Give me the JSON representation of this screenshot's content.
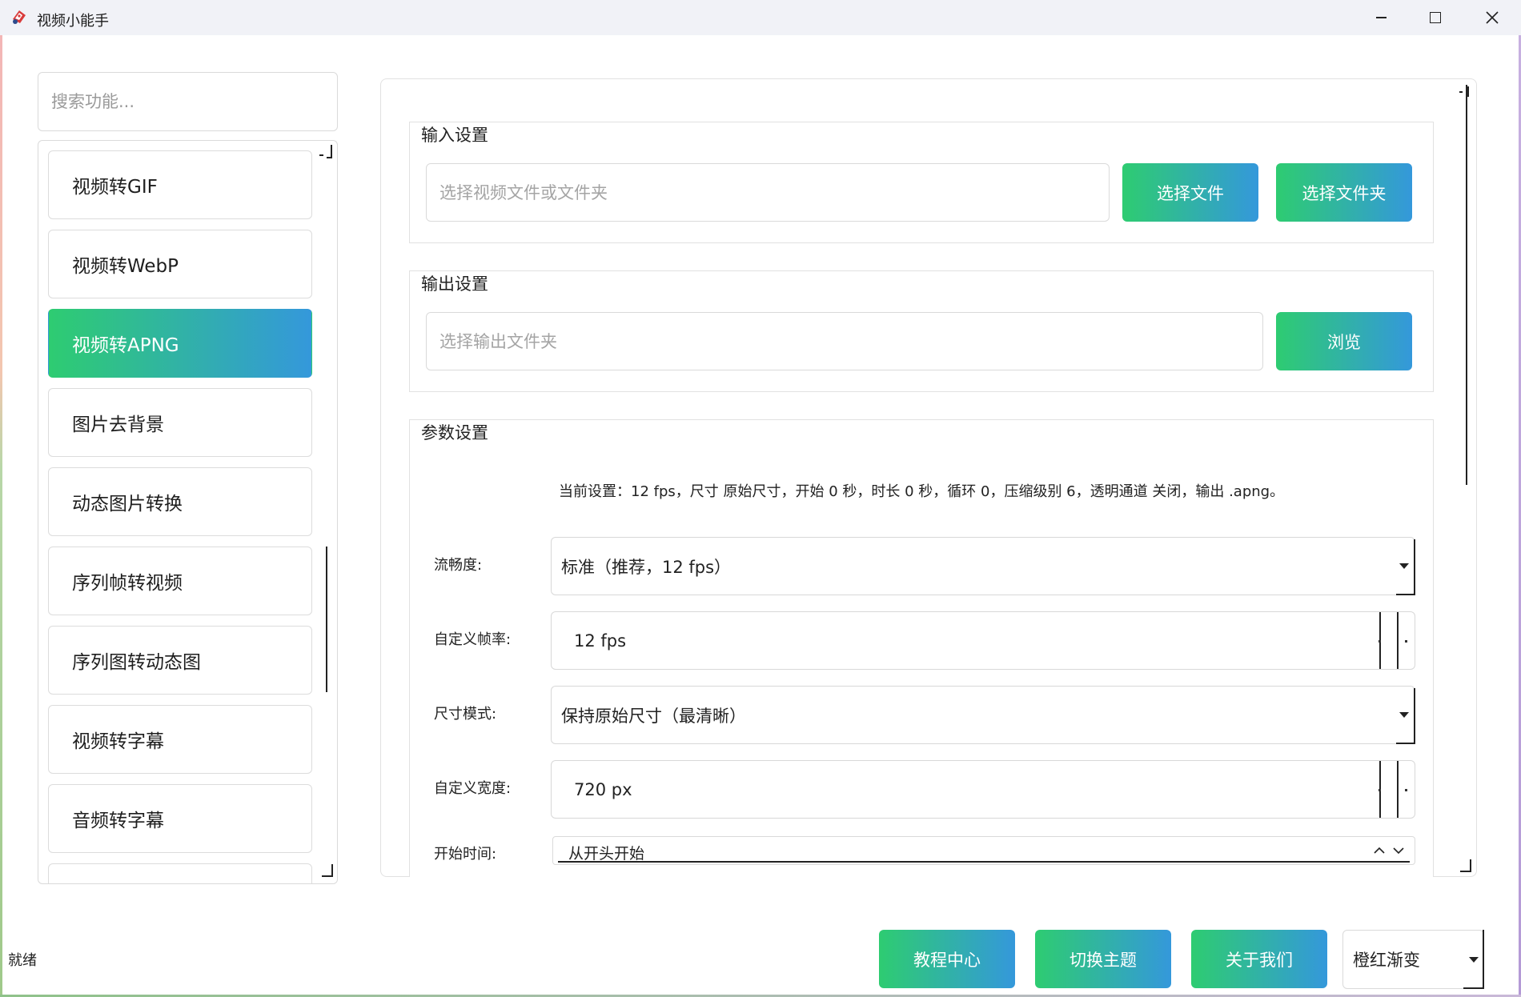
{
  "window": {
    "title": "视频小能手",
    "controls": {
      "minimize": "minimize",
      "maximize": "maximize",
      "close": "close"
    }
  },
  "sidebar": {
    "search_placeholder": "搜索功能...",
    "items": [
      {
        "label": "视频转GIF",
        "active": false
      },
      {
        "label": "视频转WebP",
        "active": false
      },
      {
        "label": "视频转APNG",
        "active": true
      },
      {
        "label": "图片去背景",
        "active": false
      },
      {
        "label": "动态图片转换",
        "active": false
      },
      {
        "label": "序列帧转视频",
        "active": false
      },
      {
        "label": "序列图转动态图",
        "active": false
      },
      {
        "label": "视频转字幕",
        "active": false
      },
      {
        "label": "音频转字幕",
        "active": false
      }
    ]
  },
  "input_settings": {
    "title": "输入设置",
    "placeholder": "选择视频文件或文件夹",
    "select_file_label": "选择文件",
    "select_folder_label": "选择文件夹"
  },
  "output_settings": {
    "title": "输出设置",
    "placeholder": "选择输出文件夹",
    "browse_label": "浏览"
  },
  "params": {
    "title": "参数设置",
    "summary": "当前设置：12 fps，尺寸 原始尺寸，开始 0 秒，时长 0 秒，循环 0，压缩级别 6，透明通道 关闭，输出 .apng。",
    "smoothness": {
      "label": "流畅度:",
      "value": "标准（推荐，12 fps）"
    },
    "custom_fps": {
      "label": "自定义帧率:",
      "value": "12 fps"
    },
    "size_mode": {
      "label": "尺寸模式:",
      "value": "保持原始尺寸（最清晰）"
    },
    "custom_width": {
      "label": "自定义宽度:",
      "value": "720 px"
    },
    "start_time": {
      "label": "开始时间:",
      "value": "从开头开始"
    }
  },
  "status": {
    "text": "就绪"
  },
  "bottom_bar": {
    "tutorial_label": "教程中心",
    "switch_theme_label": "切换主题",
    "about_label": "关于我们",
    "theme_value": "橙红渐变"
  },
  "colors": {
    "gradient_start": "#2ecc71",
    "gradient_end": "#3498db",
    "titlebar_bg": "#f1f2f7"
  }
}
